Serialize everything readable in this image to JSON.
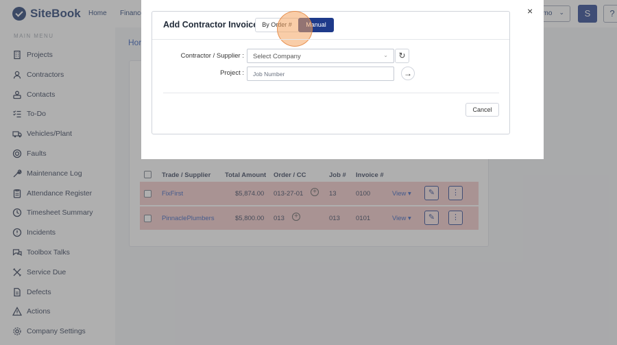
{
  "app": {
    "name": "SiteBook"
  },
  "topnav": {
    "items": [
      "Home",
      "Finance"
    ]
  },
  "header": {
    "demo_label": "emo",
    "avatar_letter": "S",
    "help_label": "?"
  },
  "sidebar": {
    "heading": "MAIN MENU",
    "items": [
      {
        "label": "Projects",
        "icon": "building-icon"
      },
      {
        "label": "Contractors",
        "icon": "contractor-icon"
      },
      {
        "label": "Contacts",
        "icon": "contacts-icon"
      },
      {
        "label": "To-Do",
        "icon": "checklist-icon"
      },
      {
        "label": "Vehicles/Plant",
        "icon": "truck-icon"
      },
      {
        "label": "Faults",
        "icon": "fault-icon"
      },
      {
        "label": "Maintenance Log",
        "icon": "wrench-icon"
      },
      {
        "label": "Attendance Register",
        "icon": "clipboard-icon"
      },
      {
        "label": "Timesheet Summary",
        "icon": "clock-icon"
      },
      {
        "label": "Incidents",
        "icon": "alert-icon"
      },
      {
        "label": "Toolbox Talks",
        "icon": "chat-icon"
      },
      {
        "label": "Service Due",
        "icon": "tools-icon"
      },
      {
        "label": "Defects",
        "icon": "document-icon"
      },
      {
        "label": "Actions",
        "icon": "warning-icon"
      },
      {
        "label": "Company Settings",
        "icon": "gear-icon"
      }
    ]
  },
  "breadcrumb": "Hor",
  "table": {
    "headers": [
      "Trade / Supplier",
      "Total Amount",
      "Order / CC",
      "Job #",
      "Invoice #"
    ],
    "rows": [
      {
        "supplier": "FixFirst",
        "amount": "$5,874.00",
        "order": "013-27-01",
        "job": "13",
        "invoice": "0100",
        "view": "View"
      },
      {
        "supplier": "PinnaclePlumbers",
        "amount": "$5,800.00",
        "order": "013",
        "job": "013",
        "invoice": "0101",
        "view": "View"
      }
    ]
  },
  "modal": {
    "title": "Add Contractor Invoice",
    "tab_by_order": "By Order #",
    "tab_manual": "Manual",
    "contractor_label": "Contractor / Supplier :",
    "contractor_placeholder": "Select Company",
    "project_label": "Project :",
    "project_placeholder": "Job Number",
    "cancel_label": "Cancel",
    "close_label": "×"
  },
  "colors": {
    "brand": "#17336b",
    "primary": "#1e3a8a",
    "row_highlight": "#f3c7c7",
    "link": "#2855b8"
  }
}
